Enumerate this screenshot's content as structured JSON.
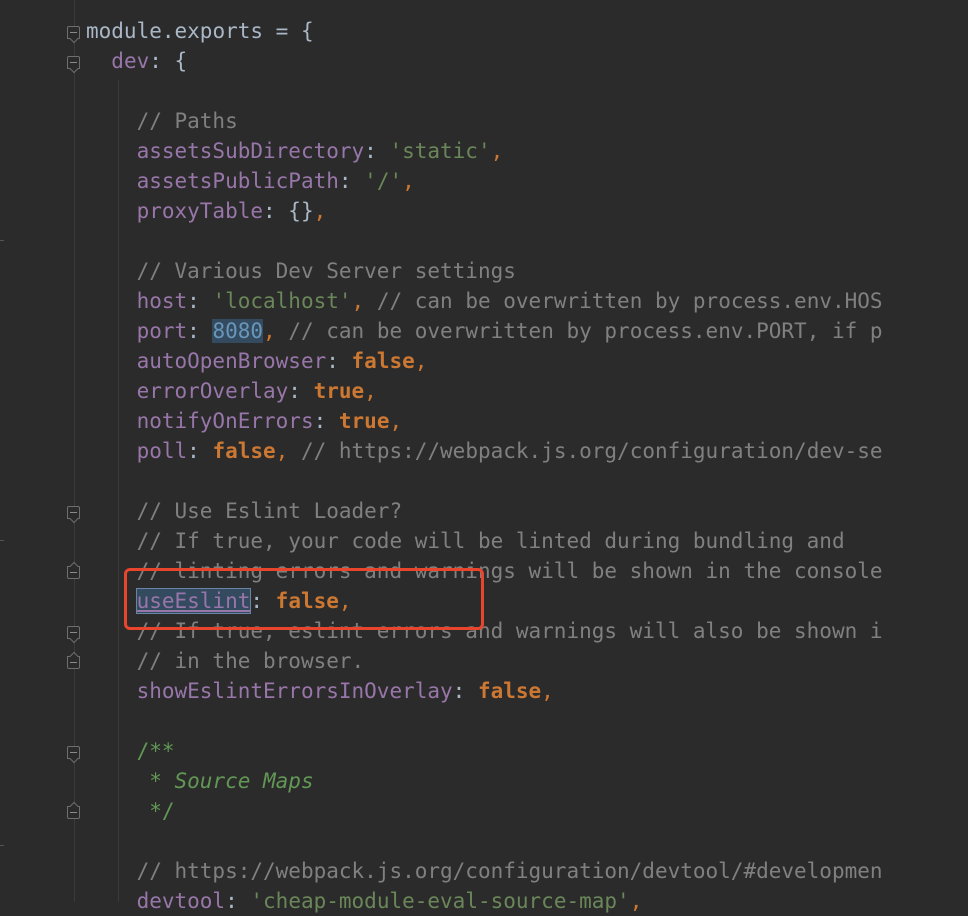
{
  "editor": {
    "lines": [
      {
        "id": "l1",
        "indent": "",
        "segments": [
          {
            "t": "module",
            "c": "plain"
          },
          {
            "t": ".",
            "c": "plain"
          },
          {
            "t": "exports",
            "c": "plain"
          },
          {
            "t": " = {",
            "c": "plain"
          }
        ]
      },
      {
        "id": "l2",
        "indent": "  ",
        "segments": [
          {
            "t": "dev",
            "c": "prop"
          },
          {
            "t": ": {",
            "c": "plain"
          }
        ]
      },
      {
        "id": "l3",
        "indent": "",
        "segments": []
      },
      {
        "id": "l4",
        "indent": "    ",
        "segments": [
          {
            "t": "// Paths",
            "c": "cmt"
          }
        ]
      },
      {
        "id": "l5",
        "indent": "    ",
        "segments": [
          {
            "t": "assetsSubDirectory",
            "c": "prop"
          },
          {
            "t": ": ",
            "c": "plain"
          },
          {
            "t": "'static'",
            "c": "str"
          },
          {
            "t": ",",
            "c": "punc"
          }
        ]
      },
      {
        "id": "l6",
        "indent": "    ",
        "segments": [
          {
            "t": "assetsPublicPath",
            "c": "prop"
          },
          {
            "t": ": ",
            "c": "plain"
          },
          {
            "t": "'/'",
            "c": "str"
          },
          {
            "t": ",",
            "c": "punc"
          }
        ]
      },
      {
        "id": "l7",
        "indent": "    ",
        "segments": [
          {
            "t": "proxyTable",
            "c": "prop"
          },
          {
            "t": ": {}",
            "c": "plain"
          },
          {
            "t": ",",
            "c": "punc"
          }
        ]
      },
      {
        "id": "l8",
        "indent": "",
        "segments": []
      },
      {
        "id": "l9",
        "indent": "    ",
        "segments": [
          {
            "t": "// Various Dev Server settings",
            "c": "cmt"
          }
        ]
      },
      {
        "id": "l10",
        "indent": "    ",
        "segments": [
          {
            "t": "host",
            "c": "prop"
          },
          {
            "t": ": ",
            "c": "plain"
          },
          {
            "t": "'localhost'",
            "c": "str"
          },
          {
            "t": ", ",
            "c": "punc"
          },
          {
            "t": "// can be overwritten by process.env.HOS",
            "c": "cmt"
          }
        ]
      },
      {
        "id": "l11",
        "indent": "    ",
        "segments": [
          {
            "t": "port",
            "c": "prop"
          },
          {
            "t": ": ",
            "c": "plain"
          },
          {
            "t": "8080",
            "c": "num"
          },
          {
            "t": ", ",
            "c": "punc"
          },
          {
            "t": "// can be overwritten by process.env.PORT, if p",
            "c": "cmt"
          }
        ]
      },
      {
        "id": "l12",
        "indent": "    ",
        "segments": [
          {
            "t": "autoOpenBrowser",
            "c": "prop"
          },
          {
            "t": ": ",
            "c": "plain"
          },
          {
            "t": "false",
            "c": "kw"
          },
          {
            "t": ",",
            "c": "punc"
          }
        ]
      },
      {
        "id": "l13",
        "indent": "    ",
        "segments": [
          {
            "t": "errorOverlay",
            "c": "prop"
          },
          {
            "t": ": ",
            "c": "plain"
          },
          {
            "t": "true",
            "c": "kw"
          },
          {
            "t": ",",
            "c": "punc"
          }
        ]
      },
      {
        "id": "l14",
        "indent": "    ",
        "segments": [
          {
            "t": "notifyOnErrors",
            "c": "prop"
          },
          {
            "t": ": ",
            "c": "plain"
          },
          {
            "t": "true",
            "c": "kw"
          },
          {
            "t": ",",
            "c": "punc"
          }
        ]
      },
      {
        "id": "l15",
        "indent": "    ",
        "segments": [
          {
            "t": "poll",
            "c": "prop"
          },
          {
            "t": ": ",
            "c": "plain"
          },
          {
            "t": "false",
            "c": "kw"
          },
          {
            "t": ", ",
            "c": "punc"
          },
          {
            "t": "// https://webpack.js.org/configuration/dev-se",
            "c": "cmt"
          }
        ]
      },
      {
        "id": "l16",
        "indent": "",
        "segments": []
      },
      {
        "id": "l17",
        "indent": "    ",
        "segments": [
          {
            "t": "// Use Eslint Loader?",
            "c": "cmt"
          }
        ]
      },
      {
        "id": "l18",
        "indent": "    ",
        "segments": [
          {
            "t": "// If true, your code will be linted during bundling and",
            "c": "cmt"
          }
        ]
      },
      {
        "id": "l19",
        "indent": "    ",
        "segments": [
          {
            "t": "// linting errors and warnings will be shown in the console",
            "c": "cmt"
          }
        ]
      },
      {
        "id": "l20",
        "indent": "    ",
        "segments": [
          {
            "t": "useEslint",
            "c": "hl-word"
          },
          {
            "t": ": ",
            "c": "plain"
          },
          {
            "t": "false",
            "c": "kw"
          },
          {
            "t": ",",
            "c": "punc"
          }
        ]
      },
      {
        "id": "l21",
        "indent": "    ",
        "segments": [
          {
            "t": "// If true, eslint errors and warnings will also be shown i",
            "c": "cmt"
          }
        ]
      },
      {
        "id": "l22",
        "indent": "    ",
        "segments": [
          {
            "t": "// in the browser.",
            "c": "cmt"
          }
        ]
      },
      {
        "id": "l23",
        "indent": "    ",
        "segments": [
          {
            "t": "showEslintErrorsInOverlay",
            "c": "prop"
          },
          {
            "t": ": ",
            "c": "plain"
          },
          {
            "t": "false",
            "c": "kw"
          },
          {
            "t": ",",
            "c": "punc"
          }
        ]
      },
      {
        "id": "l24",
        "indent": "",
        "segments": []
      },
      {
        "id": "l25",
        "indent": "    ",
        "segments": [
          {
            "t": "/**",
            "c": "doc"
          }
        ]
      },
      {
        "id": "l26",
        "indent": "     ",
        "segments": [
          {
            "t": "* ",
            "c": "doc"
          },
          {
            "t": "Source Maps",
            "c": "doc-i"
          }
        ]
      },
      {
        "id": "l27",
        "indent": "     ",
        "segments": [
          {
            "t": "*/",
            "c": "doc"
          }
        ]
      },
      {
        "id": "l28",
        "indent": "",
        "segments": []
      },
      {
        "id": "l29",
        "indent": "    ",
        "segments": [
          {
            "t": "// https://webpack.js.org/configuration/devtool/#developmen",
            "c": "cmt"
          }
        ]
      },
      {
        "id": "l30",
        "indent": "    ",
        "segments": [
          {
            "t": "devtool",
            "c": "prop"
          },
          {
            "t": ": ",
            "c": "plain"
          },
          {
            "t": "'cheap-module-eval-source-map'",
            "c": "str"
          },
          {
            "t": ",",
            "c": "punc"
          }
        ]
      }
    ]
  },
  "colors": {
    "background": "#2b2b2b",
    "keyword": "#cc7832",
    "string": "#6a8759",
    "number": "#6897bb",
    "property": "#9876aa",
    "comment": "#808080",
    "doc_comment": "#629755",
    "annotation_box": "#e8452c"
  }
}
